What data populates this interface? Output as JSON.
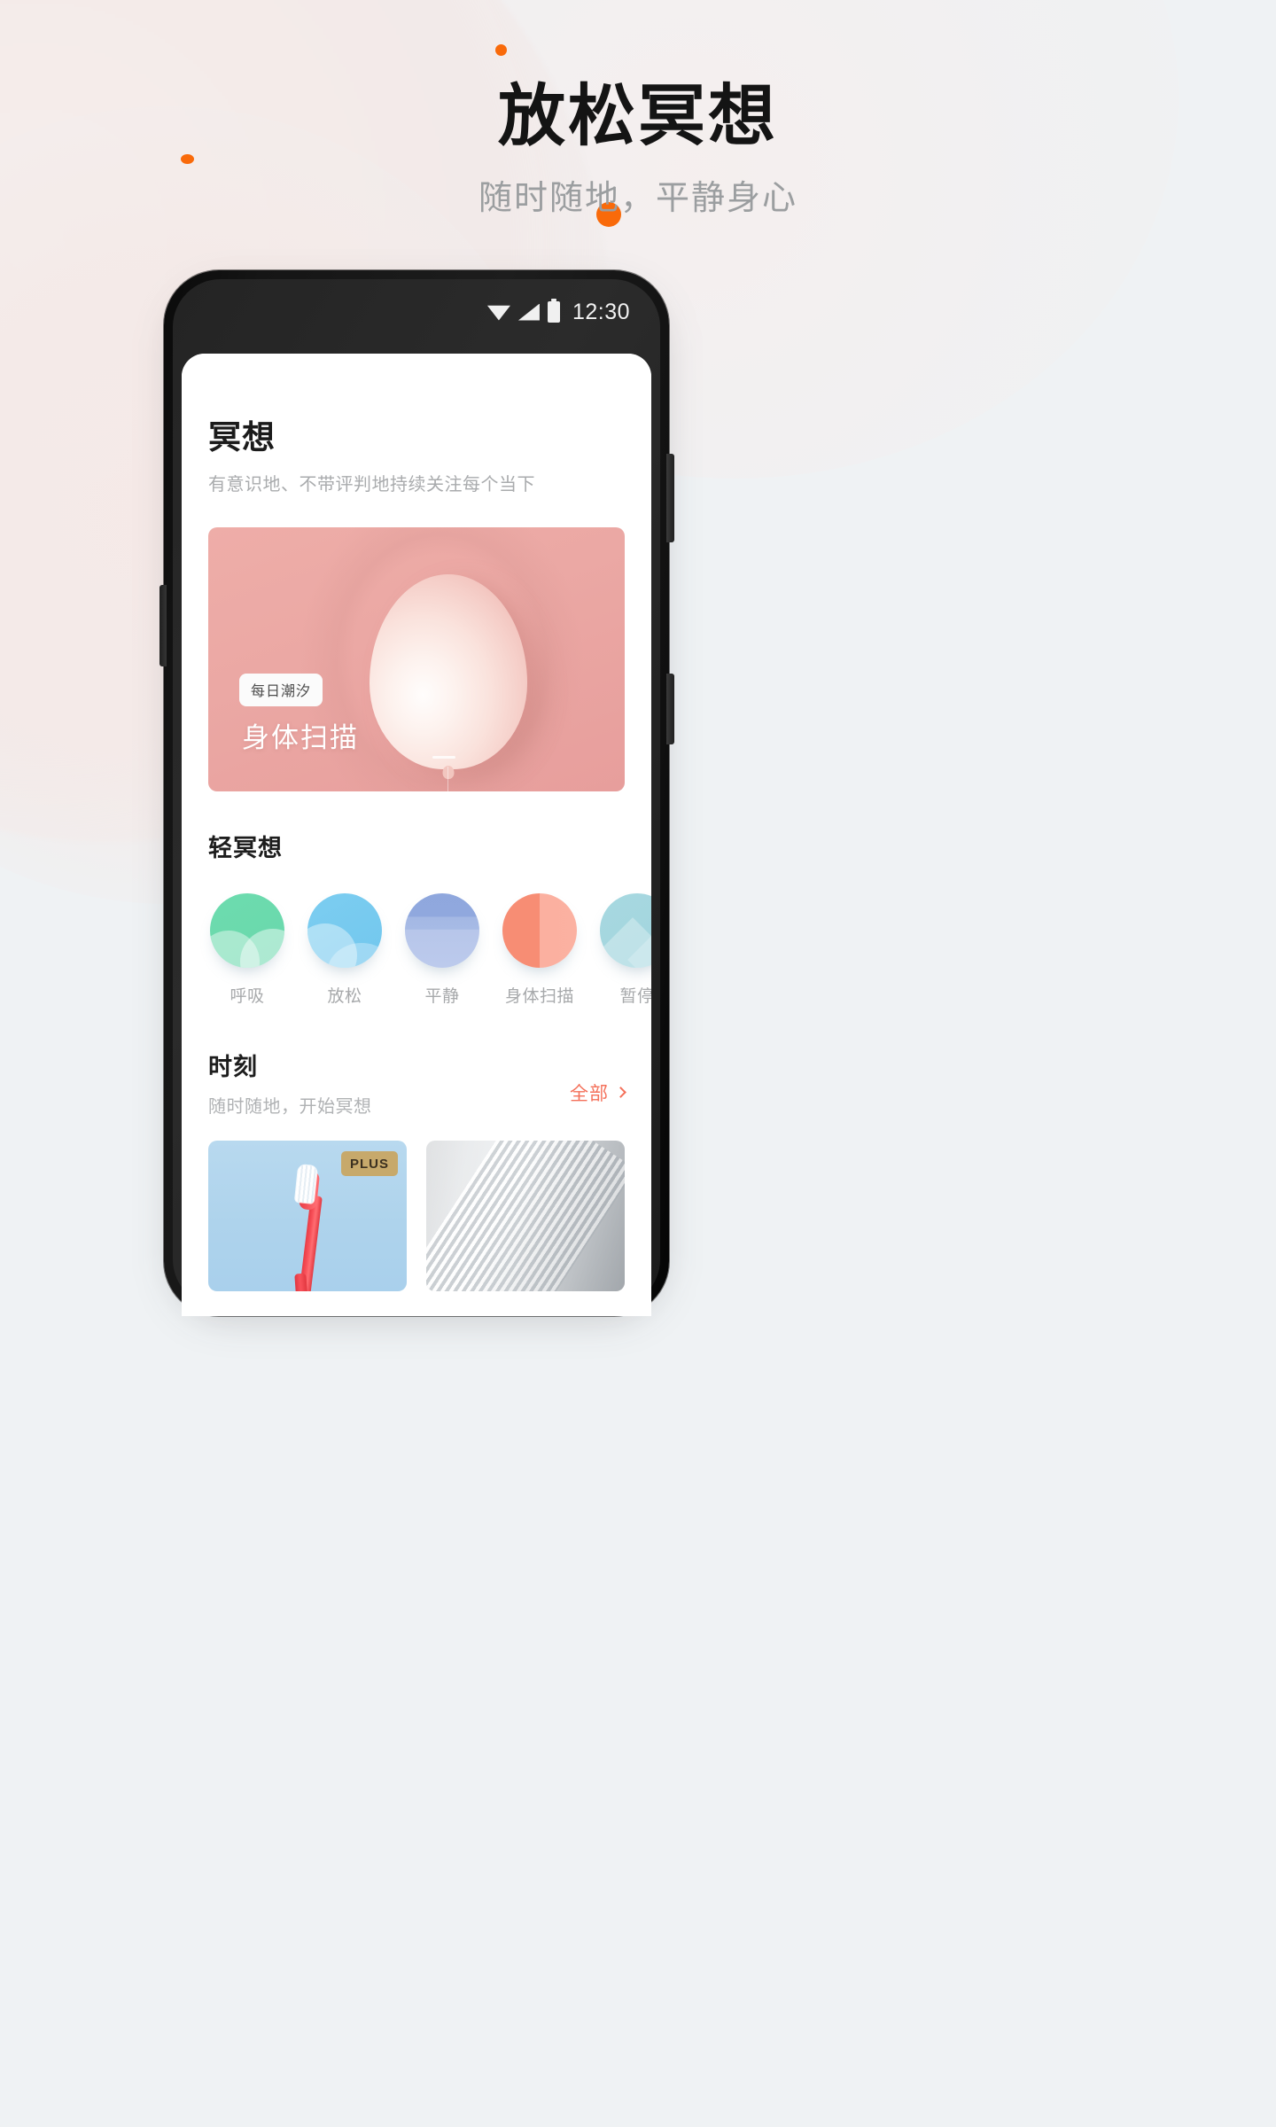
{
  "promo": {
    "headline": "放松冥想",
    "subhead": "随时随地，平静身心",
    "accent_color": "#f96a0a"
  },
  "phone": {
    "status_bar": {
      "wifi_icon": "wifi-icon",
      "signal_icon": "cellular-signal-icon",
      "battery_icon": "battery-icon",
      "time": "12:30"
    }
  },
  "app": {
    "page_title": "冥想",
    "page_subtitle": "有意识地、不带评判地持续关注每个当下",
    "hero": {
      "badge": "每日潮汐",
      "title": "身体扫描",
      "image": "pink-balloon-photo",
      "background_color": "#eba8a4"
    },
    "light_meditation": {
      "section_title": "轻冥想",
      "items": [
        {
          "label": "呼吸",
          "color": "#6ddcae"
        },
        {
          "label": "放松",
          "color": "#7ccdf0"
        },
        {
          "label": "平静",
          "color": "#8fa7dd"
        },
        {
          "label": "身体扫描",
          "color": "#f78d74"
        },
        {
          "label": "暂停",
          "color": "#a7d8e0"
        }
      ]
    },
    "moments": {
      "section_title": "时刻",
      "section_subtitle": "随时随地，开始冥想",
      "all_label": "全部",
      "chevron_icon": "chevron-right-icon",
      "cards": [
        {
          "image": "red-toothbrush-on-blue",
          "badge": "PLUS"
        },
        {
          "image": "white-diagonal-stripes-texture",
          "badge": ""
        }
      ]
    }
  }
}
